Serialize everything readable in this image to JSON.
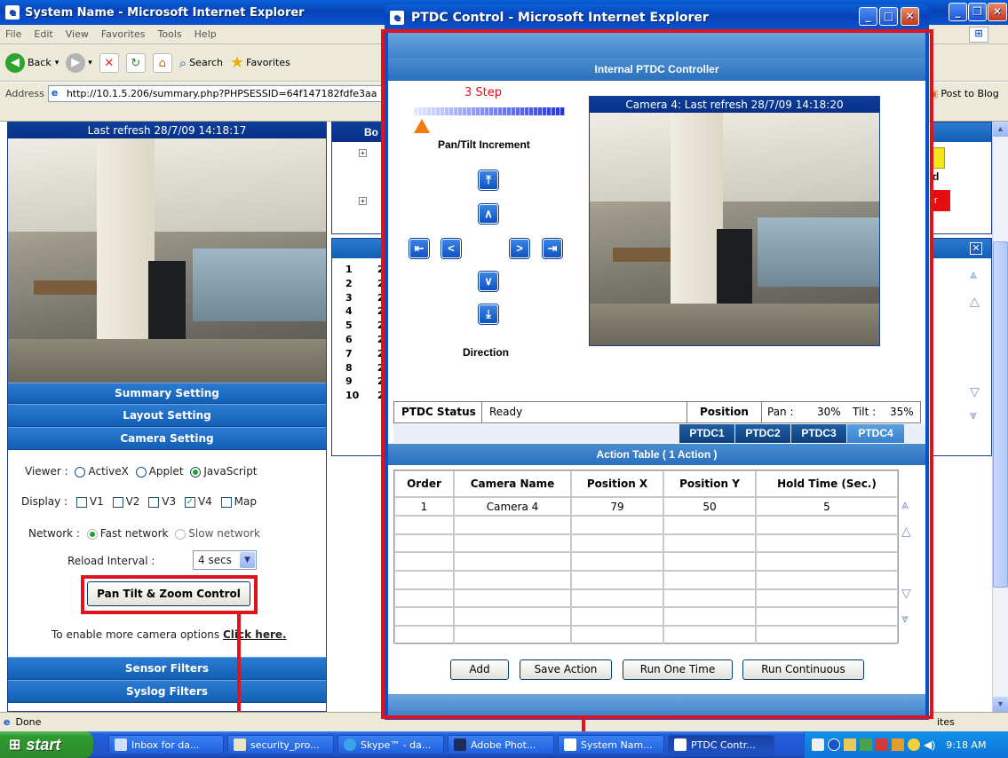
{
  "main_window": {
    "title": "System Name - Microsoft Internet Explorer",
    "menu": [
      "File",
      "Edit",
      "View",
      "Favorites",
      "Tools",
      "Help"
    ],
    "toolbar": {
      "back": "Back",
      "search": "Search",
      "favorites": "Favorites"
    },
    "address_label": "Address",
    "address_value": "http://10.1.5.206/summary.php?PHPSESSID=64f147182fdfe3aa",
    "post_to_blog": "Post to Blog",
    "last_refresh": "Last refresh 28/7/09 14:18:17",
    "settings": [
      "Summary Setting",
      "Layout Setting",
      "Camera Setting"
    ],
    "viewer_label": "Viewer :",
    "viewer_options": [
      "ActiveX",
      "Applet",
      "JavaScript"
    ],
    "viewer_selected": "JavaScript",
    "display_label": "Display :",
    "display_options": [
      "V1",
      "V2",
      "V3",
      "V4",
      "Map"
    ],
    "display_checked": "V4",
    "network_label": "Network :",
    "network_options": [
      "Fast network",
      "Slow network"
    ],
    "reload_label": "Reload Interval :",
    "reload_value": "4 secs",
    "ptz_button": "Pan Tilt & Zoom Control",
    "more_options_text": "To enable more camera options",
    "click_here": "Click here.",
    "filters": [
      "Sensor Filters",
      "Syslog Filters"
    ],
    "board_header": "Bo",
    "row_numbers": [
      "1",
      "2",
      "3",
      "4",
      "5",
      "6",
      "7",
      "8",
      "9",
      "10"
    ],
    "row_first_digits": [
      "2",
      "2",
      "2",
      "2",
      "2",
      "2",
      "2",
      "2",
      "2",
      "2"
    ],
    "right_fragments": {
      "d": "d",
      "r": "r",
      "ites": "ites"
    },
    "status": "Done"
  },
  "ptdc_window": {
    "title": "PTDC Control - Microsoft Internet Explorer",
    "header": "Internal PTDC Controller",
    "step_label": "3 Step",
    "step_value": 3,
    "increment_label": "Pan/Tilt Increment",
    "direction_label": "Direction",
    "camera_caption": "Camera 4: Last refresh 28/7/09 14:18:20",
    "status_label": "PTDC Status",
    "status_value": "Ready",
    "position_label": "Position",
    "pan_label": "Pan :",
    "pan_value": "30%",
    "tilt_label": "Tilt :",
    "tilt_value": "35%",
    "tabs": [
      "PTDC1",
      "PTDC2",
      "PTDC3",
      "PTDC4"
    ],
    "active_tab": "PTDC4",
    "action_table_title": "Action Table  ( 1 Action )",
    "columns": [
      "Order",
      "Camera Name",
      "Position X",
      "Position Y",
      "Hold Time (Sec.)"
    ],
    "rows": [
      [
        "1",
        "Camera 4",
        "79",
        "50",
        "5"
      ]
    ],
    "buttons": [
      "Add",
      "Save Action",
      "Run One Time",
      "Run Continuous"
    ]
  },
  "taskbar": {
    "start": "start",
    "items": [
      "Inbox for da...",
      "security_pro...",
      "Skype™ - da...",
      "Adobe Phot...",
      "System Nam...",
      "PTDC Contr..."
    ],
    "time": "9:18 AM"
  },
  "colors": {
    "highlight_red": "#e0121d",
    "xp_blue": "#0a54d0",
    "panel_blue": "#2a6fbd"
  }
}
